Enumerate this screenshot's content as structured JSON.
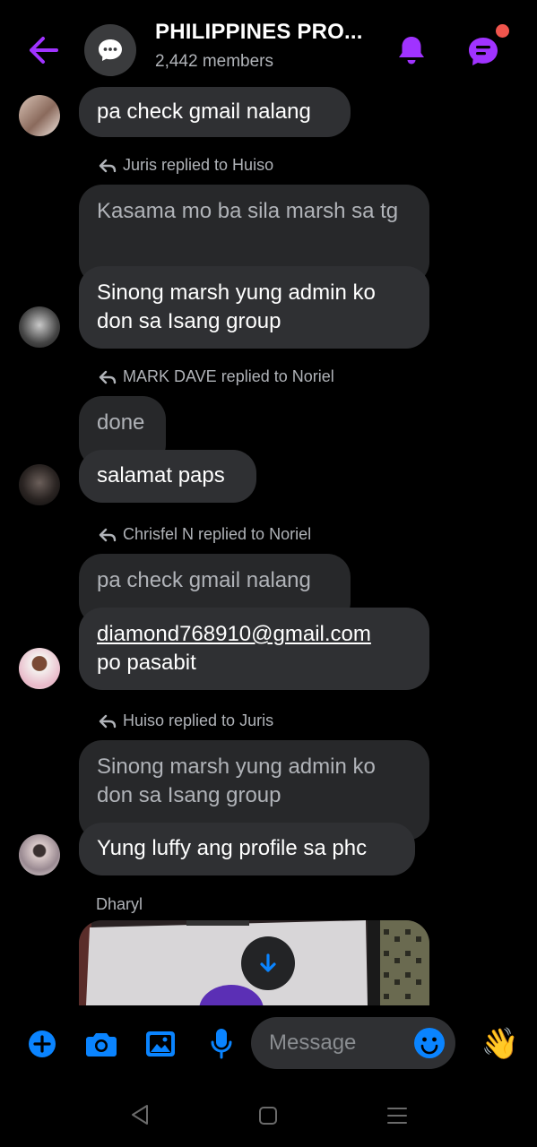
{
  "header": {
    "title": "PHILIPPINES PRO...",
    "members": "2,442 members"
  },
  "messages": {
    "m1": {
      "text": "pa check gmail nalang"
    },
    "r1": {
      "label": "Juris replied to Huiso",
      "quoted": "Kasama mo ba sila marsh sa tg",
      "text": "Sinong marsh yung admin ko don sa Isang group"
    },
    "r2": {
      "label": "MARK DAVE replied to Noriel",
      "quoted": "done",
      "text": "salamat paps"
    },
    "r3": {
      "label": "Chrisfel N replied to Noriel",
      "quoted": "pa check gmail nalang",
      "email": "diamond768910@gmail.com",
      "text_rest": "po pasabit"
    },
    "r4": {
      "label": "Huiso replied to Juris",
      "quoted": "Sinong marsh yung admin ko don sa Isang group",
      "text": "Yung luffy ang profile sa phc"
    },
    "r5": {
      "sender": "Dharyl"
    }
  },
  "composer": {
    "placeholder": "Message",
    "wave_emoji": "👋"
  },
  "icons": {
    "back": "arrow-left-icon",
    "group": "chat-bubble-icon",
    "bell": "bell-icon",
    "thread": "chat-lines-icon",
    "add": "plus-circle-icon",
    "camera": "camera-icon",
    "gallery": "image-icon",
    "mic": "microphone-icon",
    "emoji": "smiley-icon",
    "scroll_down": "arrow-down-icon"
  },
  "colors": {
    "accent": "#a033ff",
    "composer_icons": "#0a84ff",
    "bubble": "#2f3033",
    "notification": "#f0554d"
  }
}
